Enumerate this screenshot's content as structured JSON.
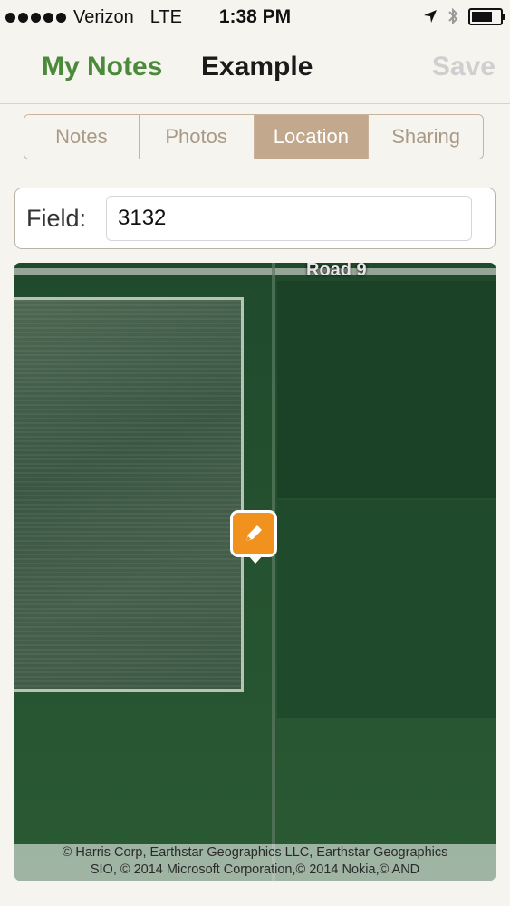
{
  "status_bar": {
    "carrier": "Verizon",
    "network": "LTE",
    "time": "1:38 PM"
  },
  "nav": {
    "back_label": "My Notes",
    "title": "Example",
    "save_label": "Save"
  },
  "tabs": [
    {
      "label": "Notes"
    },
    {
      "label": "Photos"
    },
    {
      "label": "Location"
    },
    {
      "label": "Sharing"
    }
  ],
  "active_tab": "Location",
  "field": {
    "label": "Field:",
    "value": "3132"
  },
  "map": {
    "road_label": "Road 9",
    "attribution_line1": "© Harris Corp, Earthstar Geographics LLC, Earthstar Geographics",
    "attribution_line2": "SIO, © 2014 Microsoft Corporation,© 2014 Nokia,© AND",
    "pin_color": "#f0921d"
  },
  "colors": {
    "accent_green": "#4b8a3a",
    "tab_active": "#c2a88d",
    "tab_border": "#c9b39a"
  }
}
